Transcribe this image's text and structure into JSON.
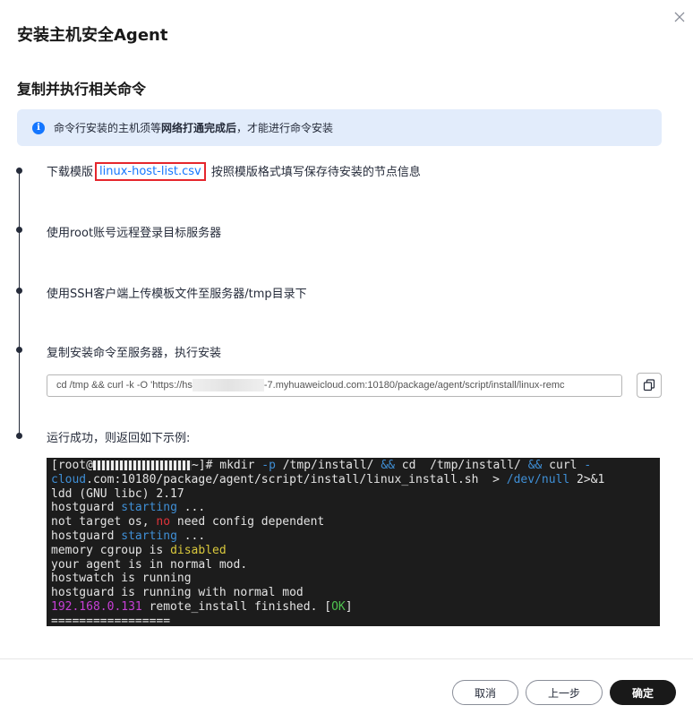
{
  "dialog": {
    "title": "安装主机安全Agent",
    "section_title": "复制并执行相关命令"
  },
  "notice": {
    "icon": "info-icon",
    "text_before": "命令行安装的主机须等",
    "text_bold": "网络打通完成后",
    "text_after": "，才能进行命令安装"
  },
  "steps": [
    {
      "prefix": "下载模版",
      "link": "linux-host-list.csv",
      "suffix": "按照模版格式填写保存待安装的节点信息"
    },
    {
      "text": "使用root账号远程登录目标服务器"
    },
    {
      "text": "使用SSH客户端上传模板文件至服务器/tmp目录下"
    },
    {
      "text": "复制安装命令至服务器，执行安装"
    },
    {
      "text": "运行成功，则返回如下示例:"
    }
  ],
  "command": {
    "prefix": "cd /tmp && curl -k -O 'https://hs",
    "suffix": "-7.myhuaweicloud.com:10180/package/agent/script/install/linux-remc"
  },
  "terminal": {
    "line1_a": "[root@",
    "line1_b": "~]# mkdir ",
    "line1_c": "-p",
    "line1_d": " /tmp/install/ ",
    "line1_e": "&&",
    "line1_f": " cd  /tmp/install/ ",
    "line1_g": "&&",
    "line1_h": " curl ",
    "line1_i": "-",
    "line2_a": "cloud",
    "line2_b": ".com:10180/package/agent/script/install/linux_install.sh  > ",
    "line2_c": "/dev/null",
    "line2_d": " 2>&1",
    "line3": "ldd (GNU libc) 2.17",
    "line4_a": "hostguard ",
    "line4_b": "starting",
    "line4_c": " ...",
    "line5_a": "not target os, ",
    "line5_b": "no",
    "line5_c": " need config dependent",
    "line6_a": "hostguard ",
    "line6_b": "starting",
    "line6_c": " ...",
    "line7_a": "memory cgroup is ",
    "line7_b": "disabled",
    "line8": "your agent is in normal mod.",
    "line9": "hostwatch is running",
    "line10": "hostguard is running with normal mod",
    "line11_a": "192.168.0.131",
    "line11_b": " remote_install finished. [",
    "line11_c": "OK",
    "line11_d": "]",
    "line12": "================="
  },
  "footer": {
    "cancel": "取消",
    "prev": "上一步",
    "ok": "确定"
  },
  "colors": {
    "primary": "#1476ff",
    "highlight_box": "#e5262d",
    "notice_bg": "#e2ecfb",
    "terminal_bg": "#1c1c1c",
    "ok_button": "#191919"
  }
}
